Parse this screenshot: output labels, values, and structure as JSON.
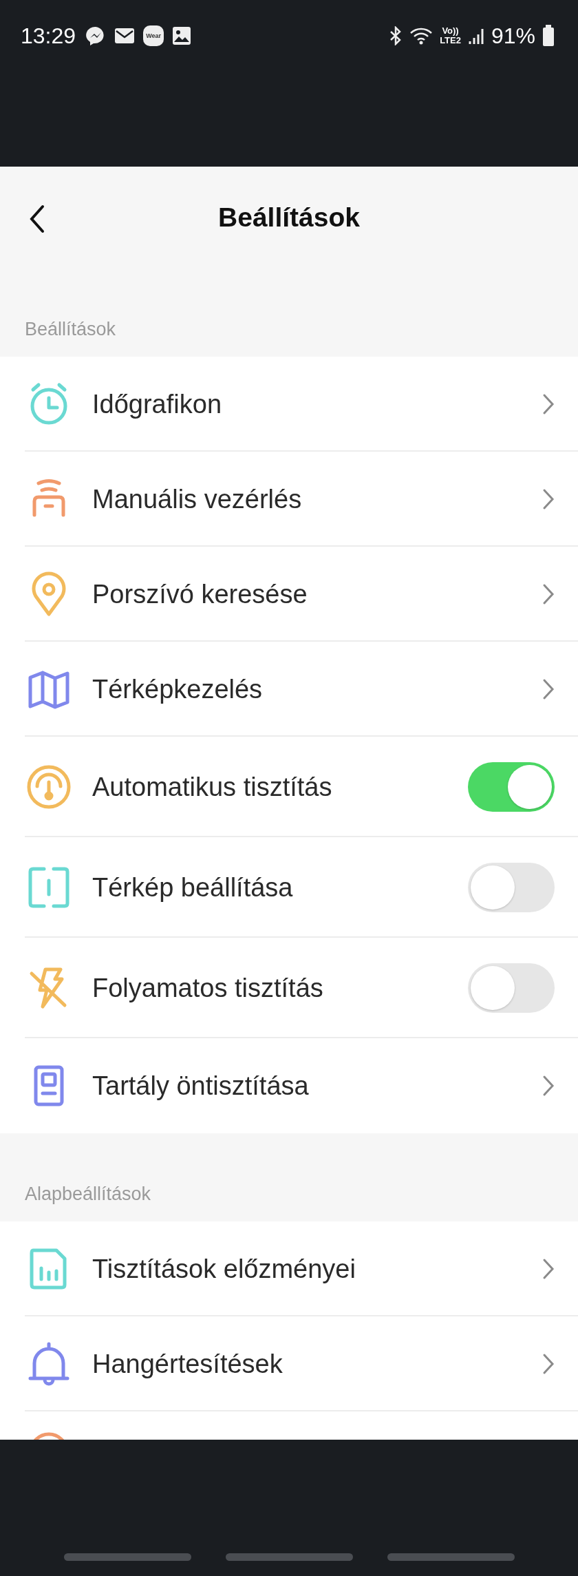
{
  "status_bar": {
    "time": "13:29",
    "notifications": [
      {
        "kind": "messenger"
      },
      {
        "kind": "mail"
      },
      {
        "kind": "badge",
        "label": "Wear"
      },
      {
        "kind": "gallery"
      }
    ],
    "network_lines": [
      "Vo))",
      "LTE2"
    ],
    "battery": "91%"
  },
  "header": {
    "title": "Beállítások"
  },
  "sections": [
    {
      "title": "Beállítások",
      "items": [
        {
          "kind": "link",
          "color": "#6ad9d2",
          "label": "Időgrafikon"
        },
        {
          "kind": "link",
          "color": "#f19a6c",
          "label": "Manuális vezérlés"
        },
        {
          "kind": "link",
          "color": "#f2ba5c",
          "label": "Porszívó keresése"
        },
        {
          "kind": "link",
          "color": "#8088ec",
          "label": "Térképkezelés"
        },
        {
          "kind": "toggle",
          "color": "#f2ba5c",
          "label": "Automatikus tisztítás",
          "on": true
        },
        {
          "kind": "toggle",
          "color": "#6ad9d2",
          "label": "Térkép beállítása",
          "on": false
        },
        {
          "kind": "toggle",
          "color": "#f2ba5c",
          "label": "Folyamatos tisztítás",
          "on": false
        },
        {
          "kind": "link",
          "color": "#8088ec",
          "label": "Tartály öntisztítása"
        }
      ]
    },
    {
      "title": "Alapbeállítások",
      "items": [
        {
          "kind": "link",
          "color": "#6ad9d2",
          "label": "Tisztítások előzményei"
        },
        {
          "kind": "link",
          "color": "#8088ec",
          "label": "Hangértesítések"
        },
        {
          "kind": "partial",
          "color": "#f19a6c"
        }
      ]
    }
  ]
}
